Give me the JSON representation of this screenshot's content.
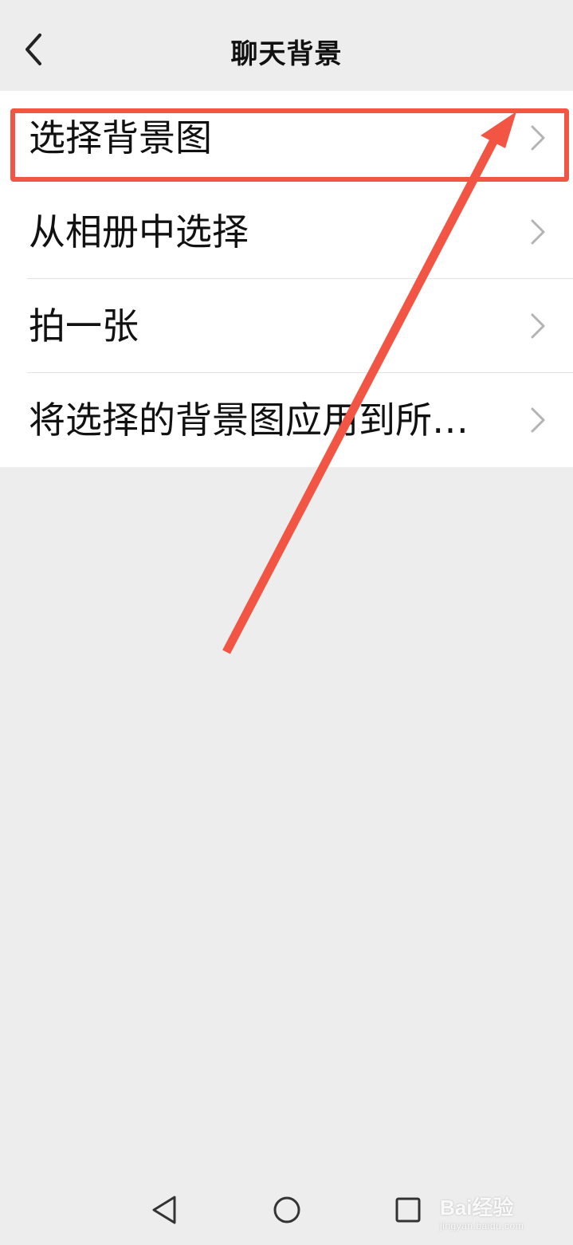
{
  "header": {
    "title": "聊天背景"
  },
  "menu": {
    "items": [
      {
        "label": "选择背景图"
      },
      {
        "label": "从相册中选择"
      },
      {
        "label": "拍一张"
      },
      {
        "label": "将选择的背景图应用到所…"
      }
    ]
  },
  "annotation": {
    "color": "#f25544"
  },
  "watermark": {
    "brand": "Bai经验",
    "url": "jingyan.baidu.com"
  },
  "icons": {
    "back": "chevron-left-icon",
    "chevron": "chevron-right-icon",
    "nav_back": "triangle-back-icon",
    "nav_home": "circle-home-icon",
    "nav_recent": "square-recent-icon"
  }
}
